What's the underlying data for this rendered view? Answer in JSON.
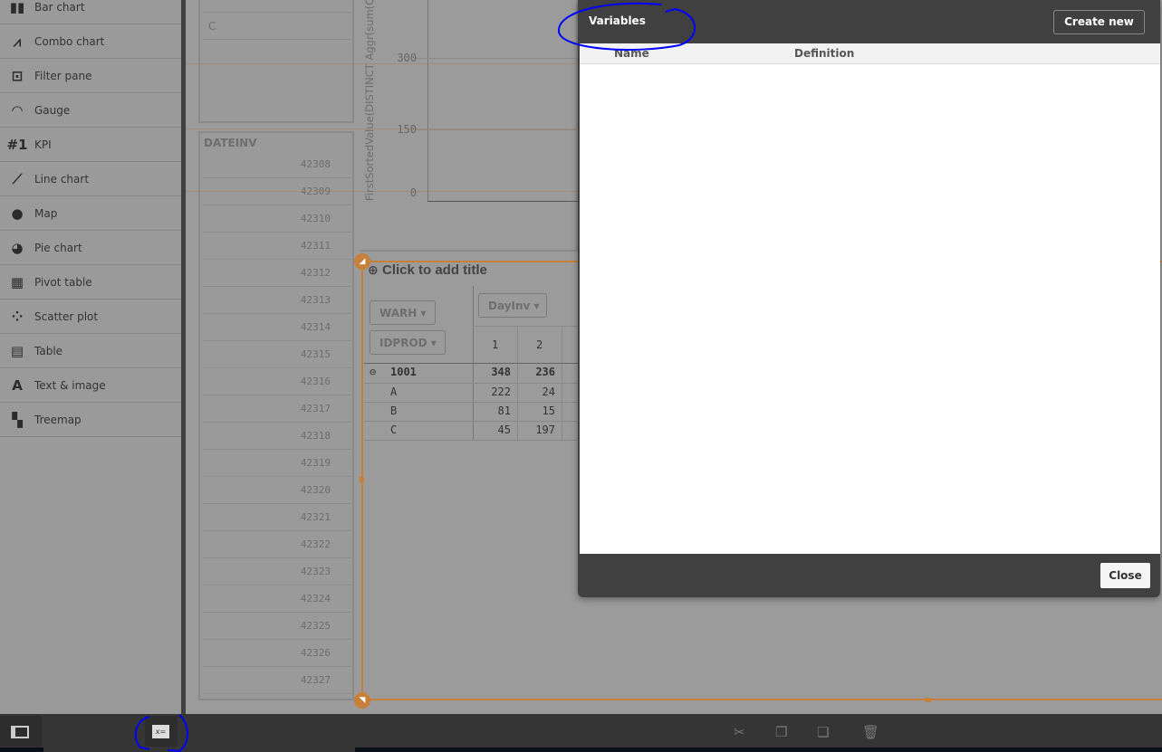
{
  "sidebar": {
    "items": [
      {
        "label": "Bar chart",
        "icon": "bar-chart-icon",
        "glyph": "▮▮"
      },
      {
        "label": "Combo chart",
        "icon": "combo-chart-icon",
        "glyph": "⩘"
      },
      {
        "label": "Filter pane",
        "icon": "filter-pane-icon",
        "glyph": "⊡"
      },
      {
        "label": "Gauge",
        "icon": "gauge-icon",
        "glyph": "◠"
      },
      {
        "label": "KPI",
        "icon": "kpi-icon",
        "glyph": "#1"
      },
      {
        "label": "Line chart",
        "icon": "line-chart-icon",
        "glyph": "⟋"
      },
      {
        "label": "Map",
        "icon": "map-icon",
        "glyph": "●"
      },
      {
        "label": "Pie chart",
        "icon": "pie-chart-icon",
        "glyph": "◕"
      },
      {
        "label": "Pivot table",
        "icon": "pivot-table-icon",
        "glyph": "▦"
      },
      {
        "label": "Scatter plot",
        "icon": "scatter-plot-icon",
        "glyph": "⁘"
      },
      {
        "label": "Table",
        "icon": "table-icon",
        "glyph": "▤"
      },
      {
        "label": "Text & image",
        "icon": "text-image-icon",
        "glyph": "A"
      },
      {
        "label": "Treemap",
        "icon": "treemap-icon",
        "glyph": "▚"
      }
    ]
  },
  "filter_top": {
    "value": "C"
  },
  "dateinv": {
    "title": "DATEINV",
    "values": [
      "42308",
      "42309",
      "42310",
      "42311",
      "42312",
      "42313",
      "42314",
      "42315",
      "42316",
      "42317",
      "42318",
      "42319",
      "42320",
      "42321",
      "42322",
      "42323",
      "42324",
      "42325",
      "42326",
      "42327"
    ]
  },
  "chart": {
    "ylabel": "FirstSortedValue(DISTINCT Aggr(sum(QT",
    "yticks": [
      "300",
      "150",
      "0"
    ]
  },
  "pivot": {
    "title": "Click to add title",
    "row_dims": [
      "WARH",
      "IDPROD"
    ],
    "col_dim": "DayInv",
    "col_headers": [
      "1",
      "2"
    ],
    "rows": [
      {
        "label": "1001",
        "values": [
          "348",
          "236"
        ],
        "bold": true
      },
      {
        "label": "A",
        "values": [
          "222",
          "24"
        ]
      },
      {
        "label": "B",
        "values": [
          "81",
          "15"
        ]
      },
      {
        "label": "C",
        "values": [
          "45",
          "197"
        ]
      }
    ]
  },
  "dialog": {
    "title": "Variables",
    "create_label": "Create new",
    "columns": [
      "Name",
      "Definition"
    ],
    "close_label": "Close"
  },
  "colors": {
    "accent": "#c87f3a",
    "dialog_bg": "#404040",
    "annotation": "#0000ff"
  }
}
